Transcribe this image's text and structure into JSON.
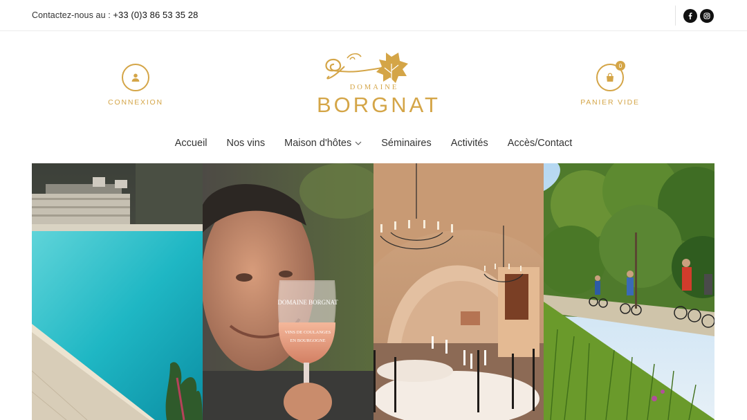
{
  "topbar": {
    "contact_prefix": "Contactez-nous au : ",
    "phone": "+33 (0)3 86 53 35 28",
    "social": [
      {
        "icon": "facebook-icon"
      },
      {
        "icon": "instagram-icon"
      }
    ]
  },
  "header": {
    "login_label": "CONNEXION",
    "cart_label": "PANIER VIDE",
    "cart_count": "0",
    "logo": {
      "line1": "DOMAINE",
      "line2": "BORGNAT"
    }
  },
  "nav": {
    "items": [
      {
        "label": "Accueil"
      },
      {
        "label": "Nos vins"
      },
      {
        "label": "Maison d'hôtes"
      },
      {
        "label": "Séminaires"
      },
      {
        "label": "Activités"
      },
      {
        "label": "Accès/Contact"
      }
    ]
  },
  "gallery": {
    "glass_text_1": "DOMAINE BORGNAT",
    "glass_text_2": "VINS DE COULANGES",
    "glass_text_3": "EN BOURGOGNE"
  },
  "colors": {
    "accent": "#d4a547",
    "text": "#333333",
    "icon_bg": "#111111"
  }
}
